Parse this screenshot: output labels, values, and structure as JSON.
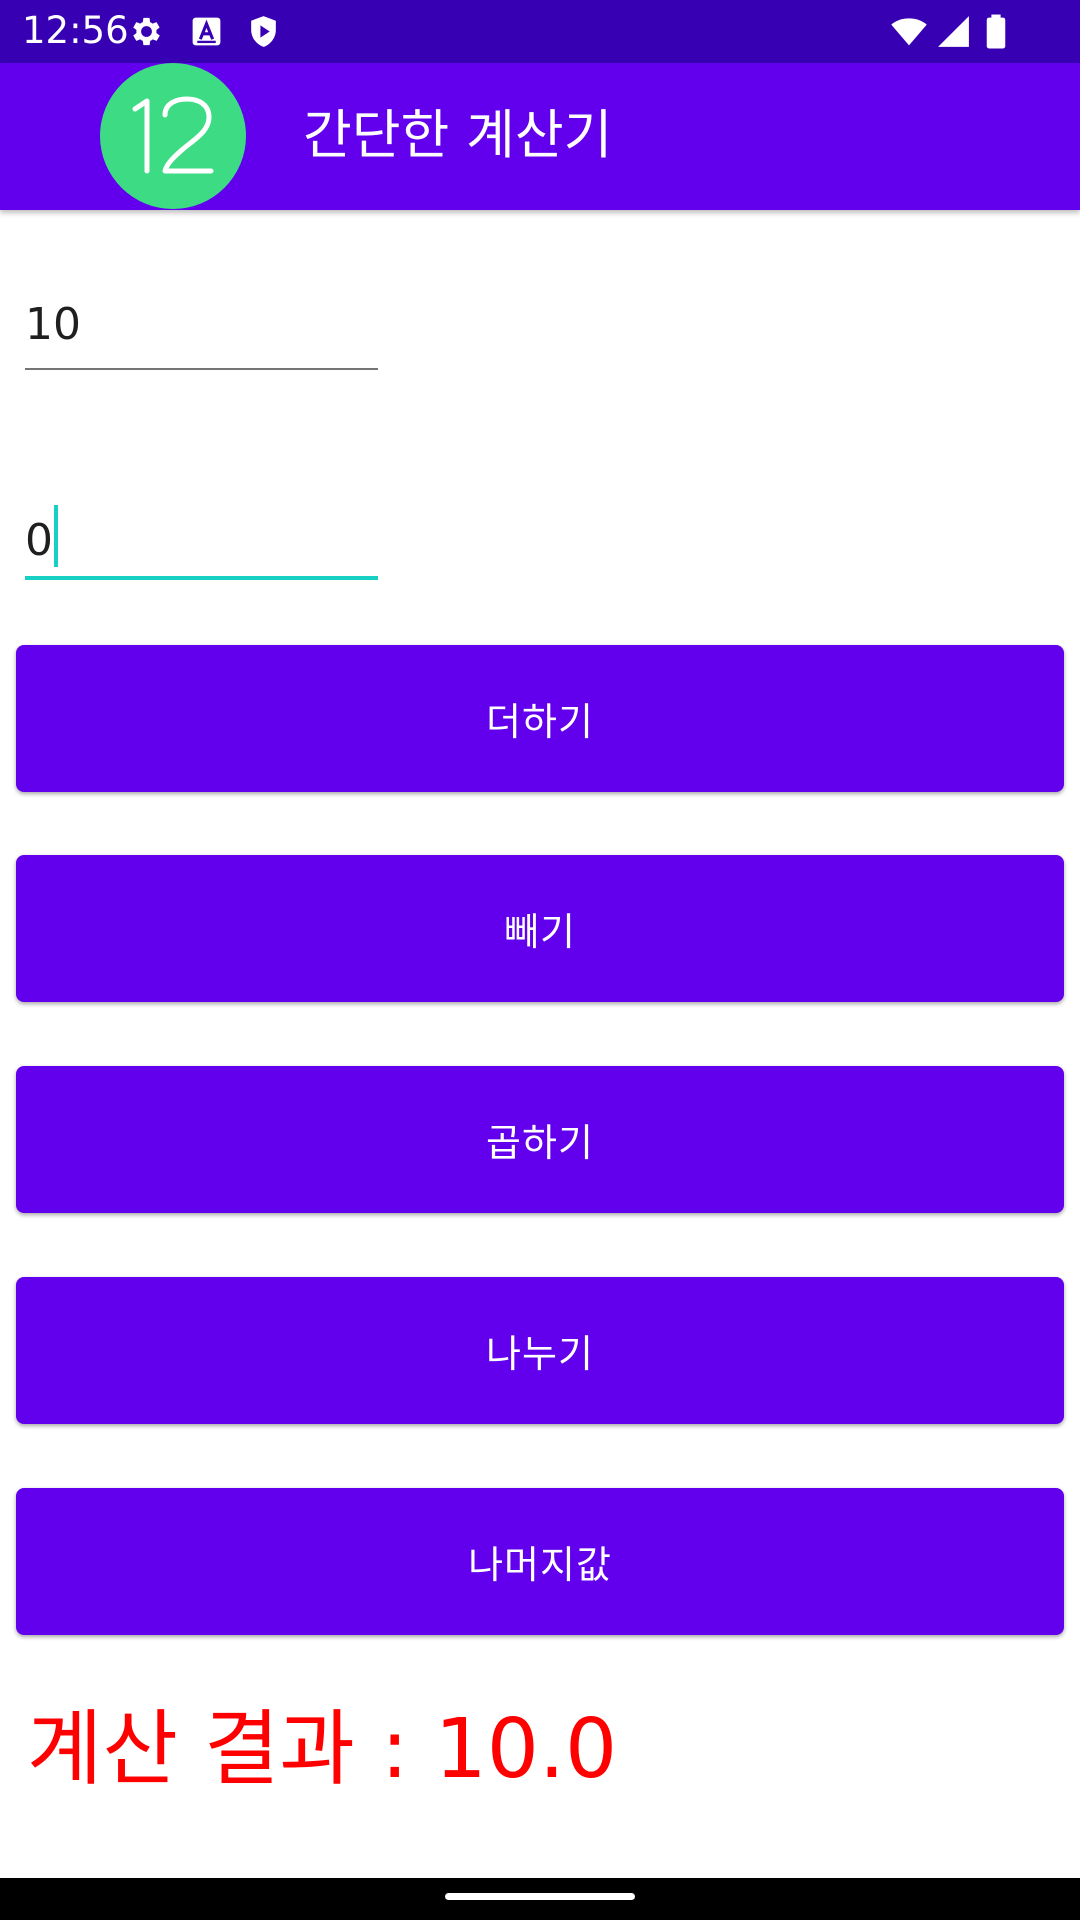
{
  "status_bar": {
    "time": "12:56",
    "left_icons": [
      "gear-icon",
      "a-badge-icon",
      "shield-play-icon"
    ],
    "right_icons": [
      "wifi-icon",
      "signal-icon",
      "battery-icon"
    ]
  },
  "app_bar": {
    "logo_text": "12",
    "title": "간단한 계산기"
  },
  "inputs": {
    "first_value": "10",
    "second_value": "0"
  },
  "buttons": {
    "add": "더하기",
    "subtract": "빼기",
    "multiply": "곱하기",
    "divide": "나누기",
    "remainder": "나머지값"
  },
  "result": {
    "text": "계산 결과 : 10.0"
  },
  "colors": {
    "status_bar": "#3700b3",
    "primary": "#6200ee",
    "accent": "#18cfc4",
    "result_text": "#ff0000",
    "logo_green": "#3ddc84"
  }
}
